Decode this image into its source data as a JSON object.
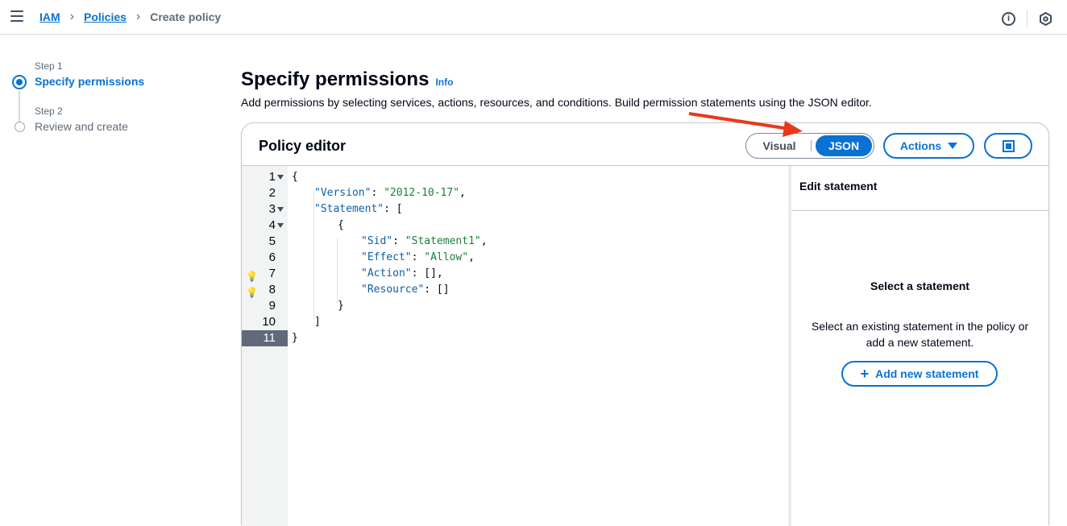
{
  "breadcrumb": {
    "items": [
      "IAM",
      "Policies"
    ],
    "current": "Create policy"
  },
  "topbar": {
    "info_icon": "i"
  },
  "steps": [
    {
      "label": "Step 1",
      "title": "Specify permissions"
    },
    {
      "label": "Step 2",
      "title": "Review and create"
    }
  ],
  "page": {
    "title": "Specify permissions",
    "info": "Info",
    "description": "Add permissions by selecting services, actions, resources, and conditions. Build permission statements using the JSON editor."
  },
  "editor": {
    "title": "Policy editor",
    "mode_visual": "Visual",
    "mode_json": "JSON",
    "actions_label": "Actions",
    "lines": [
      {
        "n": "1",
        "text": "{"
      },
      {
        "n": "2",
        "text": "\"Version\": \"2012-10-17\","
      },
      {
        "n": "3",
        "text": "\"Statement\": ["
      },
      {
        "n": "4",
        "text": "{"
      },
      {
        "n": "5",
        "text": "\"Sid\": \"Statement1\","
      },
      {
        "n": "6",
        "text": "\"Effect\": \"Allow\","
      },
      {
        "n": "7",
        "text": "\"Action\": [],"
      },
      {
        "n": "8",
        "text": "\"Resource\": []"
      },
      {
        "n": "9",
        "text": "}"
      },
      {
        "n": "10",
        "text": "]"
      },
      {
        "n": "11",
        "text": "}"
      }
    ]
  },
  "side": {
    "header": "Edit statement",
    "title": "Select a statement",
    "description": "Select an existing statement in the policy or add a new statement.",
    "add_button": "Add new statement"
  }
}
